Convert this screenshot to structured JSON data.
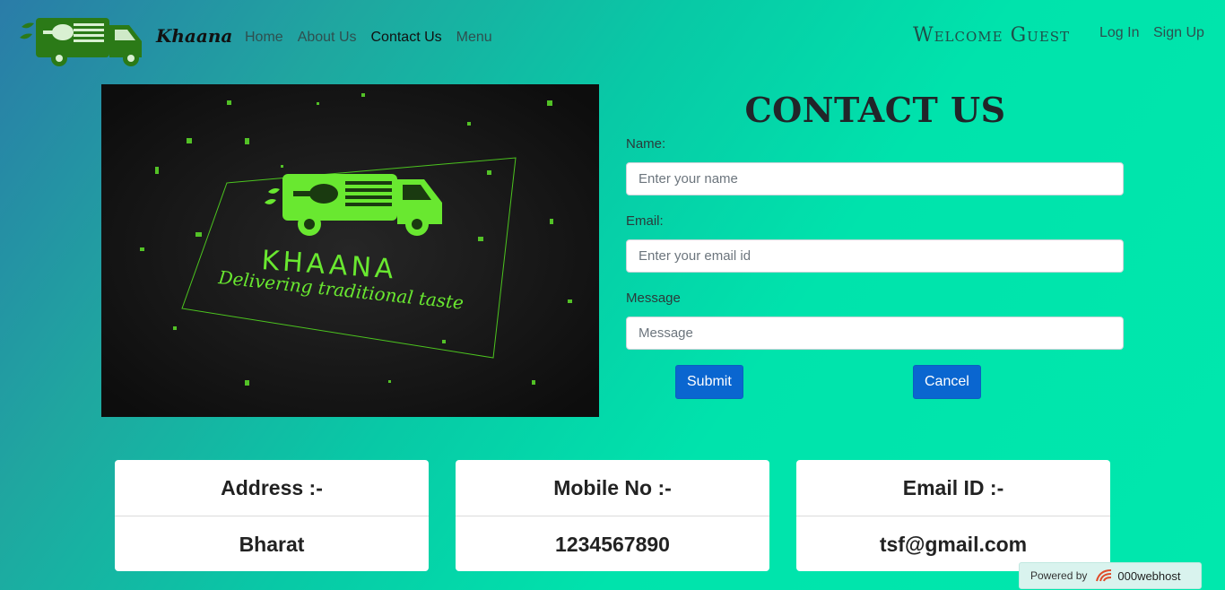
{
  "brand": {
    "name": "Khaana"
  },
  "nav": {
    "links": [
      {
        "label": "Home"
      },
      {
        "label": "About Us"
      },
      {
        "label": "Contact Us"
      },
      {
        "label": "Menu"
      }
    ],
    "welcome": "Welcome Guest",
    "login": "Log In",
    "signup": "Sign Up"
  },
  "hero": {
    "logo_text": "KHAANA",
    "tagline": "Delivering traditional taste"
  },
  "contact": {
    "title": "CONTACT US",
    "name_label": "Name:",
    "name_placeholder": "Enter your name",
    "email_label": "Email:",
    "email_placeholder": "Enter your email id",
    "message_label": "Message",
    "message_placeholder": "Message",
    "submit_label": "Submit",
    "cancel_label": "Cancel"
  },
  "cards": [
    {
      "heading": "Address :-",
      "value": "Bharat"
    },
    {
      "heading": "Mobile No :-",
      "value": "1234567890"
    },
    {
      "heading": "Email ID :-",
      "value": "tsf@gmail.com"
    }
  ],
  "footer_badge": {
    "powered_by": "Powered by",
    "host": "000webhost"
  },
  "colors": {
    "accent_button": "#0a66d0",
    "logo_green": "#2b7a17",
    "hero_green": "#5ee02a"
  }
}
